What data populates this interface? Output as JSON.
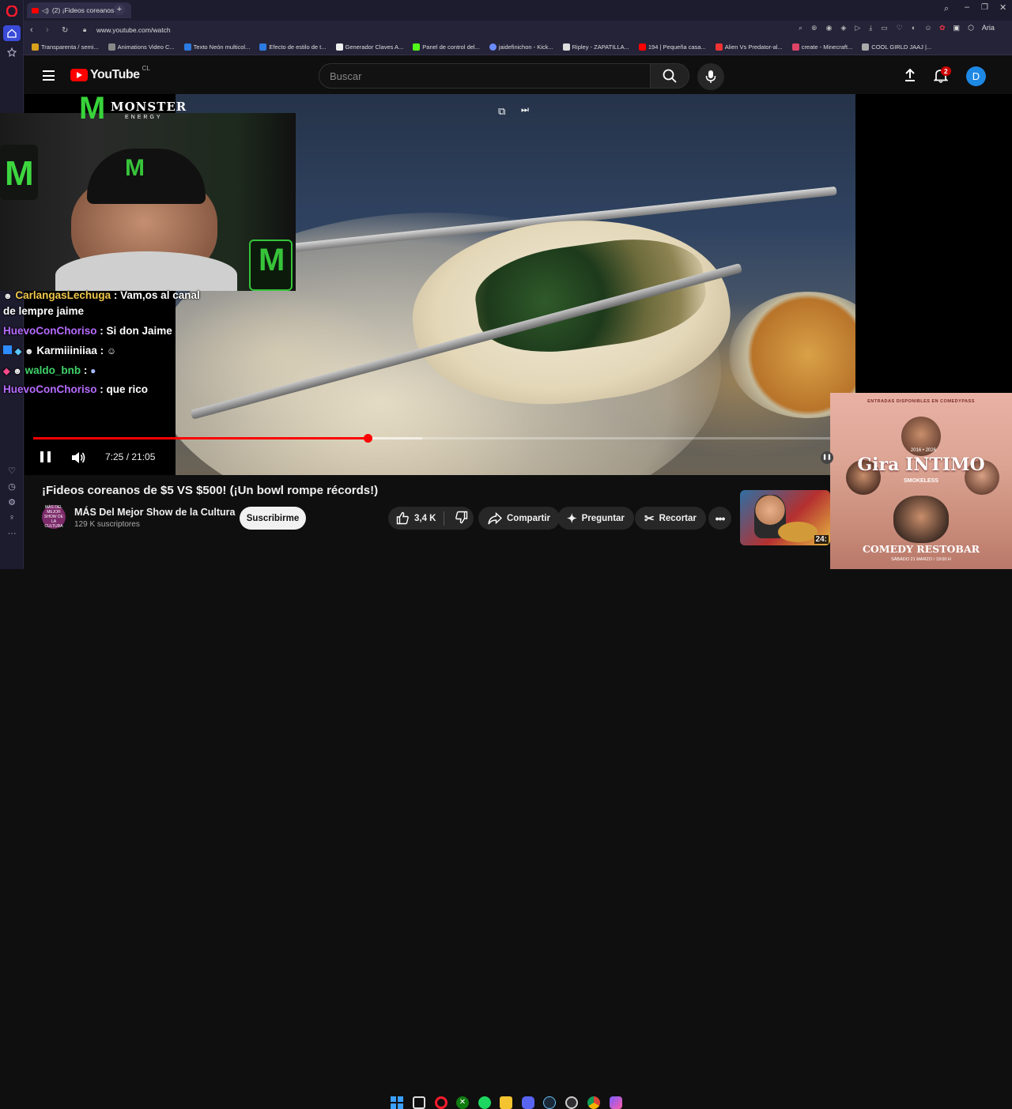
{
  "browser": {
    "tab_title": "(2) ¡Fideos coreanos d",
    "url": "www.youtube.com/watch",
    "bookmarks": [
      "Transparenta / semi...",
      "Animations Video C...",
      "Texto Neón multicol...",
      "Efecto de estilo de t...",
      "Generador Claves A...",
      "Panel de control del...",
      "jaidefinichon - Kick...",
      "Ripley - ZAPATILLA...",
      "194 | Pequeña casa...",
      "Alien Vs Predator-al...",
      "create - Minecraft...",
      "COOL GIRLD JAAJ |..."
    ],
    "extension_label": "Aria"
  },
  "youtube": {
    "logo_text": "YouTube",
    "country": "CL",
    "search_placeholder": "Buscar",
    "notification_count": "2",
    "avatar_letter": "D"
  },
  "overlay": {
    "sponsor_top": "MONSTER",
    "sponsor_sub": "ENERGY",
    "chat": [
      {
        "user": "CarlangasLechuga",
        "color": "#f0c74a",
        "message": ": Vam,os al canal"
      },
      {
        "user": "",
        "color": "#ffffff",
        "message": "de lempre jaime"
      },
      {
        "user": "HuevoConChoriso",
        "color": "#b66bff",
        "message": ": Si don Jaime"
      },
      {
        "user": "Karmiiiniiaa",
        "color": "#ffffff",
        "message": ":"
      },
      {
        "user": "waldo_bnb",
        "color": "#3fd26a",
        "message": ":"
      },
      {
        "user": "HuevoConChoriso",
        "color": "#b66bff",
        "message": ": que rico"
      }
    ]
  },
  "player": {
    "time": "7:25 / 21:05",
    "progress_fraction": 0.4187,
    "buffer_fraction": 0.487
  },
  "video": {
    "title": "¡Fideos coreanos de $5 VS $500! (¡Un bowl rompe récords!)",
    "channel_name": "MÁS Del Mejor Show de la Cultura",
    "channel_avatar_text": "MÁS DEL MEJOR SHOW DE LA CULTURA",
    "subscribers": "129 K suscriptores",
    "subscribe_label": "Suscribirme",
    "likes": "3,4 K",
    "share_label": "Compartir",
    "ask_label": "Preguntar",
    "clip_label": "Recortar",
    "related_duration": "24:"
  },
  "ad": {
    "top_text": "ENTRADAS DISPONIBLES EN COMEDYPASS",
    "title": "Gira INTIMO",
    "subtitle": "SMOKELESS",
    "years": "2016 • 2026",
    "venue": "COMEDY RESTOBAR",
    "date": "SÁBADO 21 MARZO / 19:00 H"
  },
  "colors": {
    "accent_red": "#ff0000",
    "opera_red": "#ff1b2d",
    "opera_sidebar": "#1d1b2e"
  }
}
